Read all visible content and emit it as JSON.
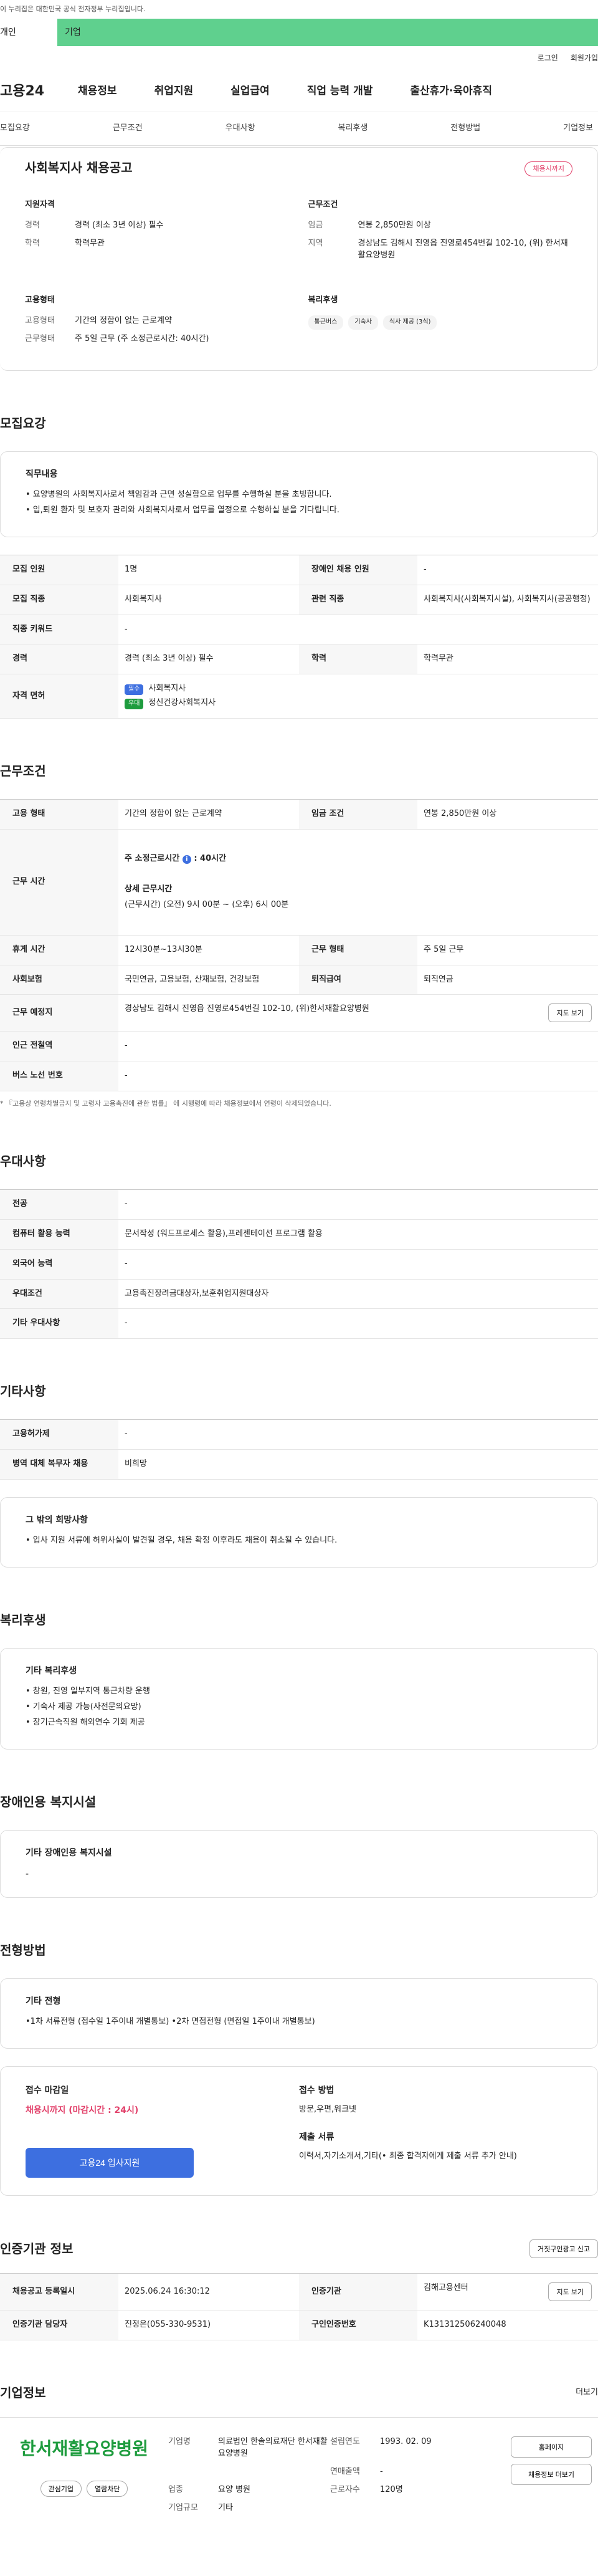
{
  "gov_banner": "이 누리집은 대한민국 공식 전자정부 누리집입니다.",
  "tabs": {
    "individual": "개인",
    "corporate": "기업"
  },
  "util": [
    "로그인",
    "회원가입"
  ],
  "logo": "고용24",
  "gnb": [
    "채용정보",
    "취업지원",
    "실업급여",
    "직업 능력 개발",
    "출산휴가·육아휴직"
  ],
  "anchors": [
    "모집요강",
    "근무조건",
    "우대사항",
    "복리후생",
    "전형방법",
    "기업정보"
  ],
  "summary": {
    "title": "사회복지사 채용공고",
    "badge": "채용시까지",
    "qual": {
      "heading": "지원자격",
      "rows": [
        {
          "k": "경력",
          "v": "경력 (최소 3년 이상) 필수"
        },
        {
          "k": "학력",
          "v": "학력무관"
        }
      ]
    },
    "cond": {
      "heading": "근무조건",
      "rows": [
        {
          "k": "임금",
          "v": "연봉 2,850만원 이상"
        },
        {
          "k": "지역",
          "v": "경상남도 김해시 진영읍 진영로454번길 102-10, (위) 한서재활요양병원"
        }
      ]
    },
    "emp": {
      "heading": "고용형태",
      "rows": [
        {
          "k": "고용형태",
          "v": "기간의 정함이 없는 근로계약"
        },
        {
          "k": "근무형태",
          "v": "주 5일 근무 (주 소정근로시간: 40시간)"
        }
      ]
    },
    "welfare": {
      "heading": "복리후생",
      "chips": [
        "통근버스",
        "기숙사",
        "식사 제공 (3식)"
      ]
    }
  },
  "recruit": {
    "title": "모집요강",
    "duty_heading": "직무내용",
    "duties": [
      "• 요양병원의 사회복지사로서 책임감과 근면 성실함으로 업무를 수행하실 분을 초빙합니다.",
      "• 입,퇴원 환자 및 보호자 관리와 사회복지사로서 업무를 열정으로 수행하실 분을 기다립니다."
    ],
    "rows": [
      {
        "k1": "모집 인원",
        "v1": "1명",
        "k2": "장애인 채용 인원",
        "v2": "-"
      },
      {
        "k1": "모집 직종",
        "v1": "사회복지사",
        "k2": "관련 직종",
        "v2": "사회복지사(사회복지시설), 사회복지사(공공행정)"
      },
      {
        "k1": "직종 키워드",
        "v1": "-"
      },
      {
        "k1": "경력",
        "v1": "경력 (최소 3년 이상) 필수",
        "k2": "학력",
        "v2": "학력무관"
      }
    ],
    "license_key": "자격 면허",
    "licenses": [
      {
        "tag": "필수",
        "name": "사회복지사",
        "color": "#3d6fe0"
      },
      {
        "tag": "우대",
        "name": "정신건강사회복지사",
        "color": "#1e9c3e"
      }
    ]
  },
  "work": {
    "title": "근무조건",
    "r1": {
      "k1": "고용 형태",
      "v1": "기간의 정함이 없는 근로계약",
      "k2": "임금 조건",
      "v2": "연봉 2,850만원 이상"
    },
    "hours": {
      "k": "근무 시간",
      "weekly": "주 소정근로시간",
      "weekly_val": ": 40시간",
      "detail_heading": "상세 근무시간",
      "detail": "(근무시간) (오전) 9시 00분 ~ (오후) 6시 00분"
    },
    "r3": {
      "k1": "휴게 시간",
      "v1": "12시30분~13시30분",
      "k2": "근무 형태",
      "v2": "주 5일 근무"
    },
    "r4": {
      "k1": "사회보험",
      "v1": "국민연금, 고용보험, 산재보험, 건강보험",
      "k2": "퇴직급여",
      "v2": "퇴직연금"
    },
    "r5": {
      "k": "근무 예정지",
      "v": "경상남도 김해시 진영읍 진영로454번길 102-10, (위)한서재활요양병원",
      "btn": "지도 보기"
    },
    "r6": {
      "k": "인근 전철역",
      "v": "-"
    },
    "r7": {
      "k": "버스 노선 번호",
      "v": "-"
    },
    "note": "* 『고용상 연령차별금지 및 고령자 고용촉진에 관한 법률』 에 시행령에 따라 채용정보에서 연령이 삭제되었습니다."
  },
  "pref": {
    "title": "우대사항",
    "rows": [
      {
        "k": "전공",
        "v": "-"
      },
      {
        "k": "컴퓨터 활용 능력",
        "v": "문서작성 (워드프로세스 활용),프레젠테이션 프로그램 활용"
      },
      {
        "k": "외국어 능력",
        "v": "-"
      },
      {
        "k": "우대조건",
        "v": "고용촉진장려금대상자,보훈취업지원대상자"
      },
      {
        "k": "기타 우대사항",
        "v": "-"
      }
    ]
  },
  "etc": {
    "title": "기타사항",
    "rows": [
      {
        "k": "고용허가제",
        "v": "-"
      },
      {
        "k": "병역 대체 복무자 채용",
        "v": "비희망"
      }
    ],
    "box_heading": "그 밖의 희망사항",
    "box_text": "• 입사 지원 서류에 허위사실이 발견될 경우, 채용 확정 이후라도 채용이 취소될 수 있습니다."
  },
  "benefit": {
    "title": "복리후생",
    "heading": "기타 복리후생",
    "items": [
      "• 창원, 진영 일부지역 통근차량 운행",
      "• 기숙사 제공 가능(사전문의요망)",
      "• 장기근속직원 해외연수 기회 제공"
    ]
  },
  "disabled": {
    "title": "장애인용 복지시설",
    "heading": "기타 장애인용 복지시설",
    "text": "-"
  },
  "process": {
    "title": "전형방법",
    "heading": "기타 전형",
    "text": "•1차 서류전형 (접수일 1주이내 개별통보) •2차 면접전형 (면접일 1주이내 개별통보)",
    "deadline_heading": "접수 마감일",
    "deadline": "채용시까지 (마감시간 : 24시)",
    "apply": "고용24 입사지원",
    "method_heading": "접수 방법",
    "method": "방문,우편,워크넷",
    "docs_heading": "제출 서류",
    "docs": "이력서,자기소개서,기타(• 최종 합격자에게 제출 서류 추가 안내)"
  },
  "cert": {
    "title": "인증기관 정보",
    "report": "거짓구인광고 신고",
    "r1": {
      "k1": "채용공고 등록일시",
      "v1": "2025.06.24 16:30:12",
      "k2": "인증기관",
      "v2": "김해고용센터",
      "btn": "지도 보기"
    },
    "r2": {
      "k1": "인증기관 담당자",
      "v1": "진정은(055-330-9531)",
      "k2": "구인인증번호",
      "v2": "K131312506240048"
    }
  },
  "company": {
    "title": "기업정보",
    "more": "더보기",
    "logo_text": "한서재활요양병원",
    "interest": "관심기업",
    "block": "열람차단",
    "homepage": "홈페이지",
    "other_jobs": "채용정보 더보기",
    "info": [
      {
        "k": "기업명",
        "v": "의료법인 한솔의료재단 한서재활요양병원",
        "k2": "설립연도",
        "v2": "1993. 02. 09"
      },
      {
        "k": "",
        "v": "",
        "k2": "연매출액",
        "v2": "-"
      },
      {
        "k": "업종",
        "v": "요양 병원",
        "k2": "근로자수",
        "v2": "120명"
      },
      {
        "k": "기업규모",
        "v": "기타",
        "k2": "",
        "v2": ""
      }
    ]
  }
}
